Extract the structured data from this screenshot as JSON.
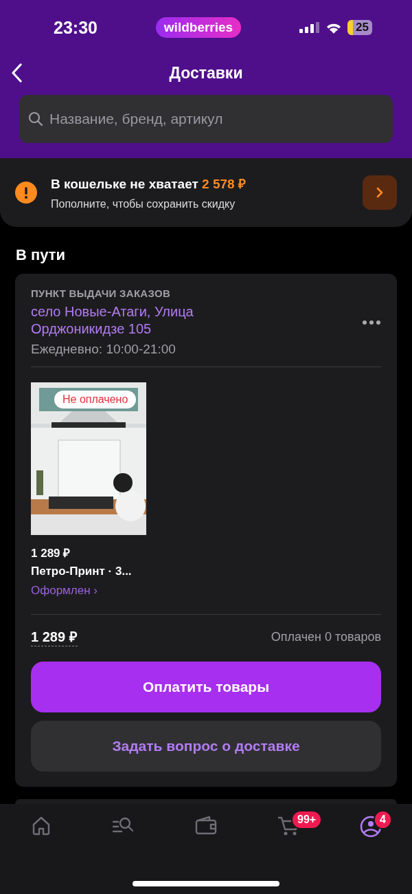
{
  "status_bar": {
    "time": "23:30",
    "app_pill": "wildberries",
    "battery": "25"
  },
  "header": {
    "title": "Доставки",
    "search": {
      "placeholder": "Название, бренд, артикул"
    }
  },
  "wallet_banner": {
    "title": "В кошельке не хватает **2 578 ₽**",
    "subtitle": "Пополните, чтобы сохранить скидку"
  },
  "section_title": "В пути",
  "delivery": {
    "point_label": "ПУНКТ ВЫДАЧИ ЗАКАЗОВ",
    "address": "село Новые-Атаги, Улица Орджоникидзе 105",
    "hours": "Ежедневно: 10:00-21:00",
    "items": [
      {
        "kind": "picture",
        "badge": "Не оплачено",
        "price": "1 289 ₽",
        "name": "Петро-Принт · 3...",
        "status": "Оформлен ›"
      }
    ],
    "total": "1 289 ₽",
    "paid_count": "Оплачен 0 товаров",
    "pay_button": "Оплатить товары",
    "ask_button": "Задать вопрос о доставке"
  },
  "tab_bar": [
    {
      "kind": "home",
      "selected": false
    },
    {
      "kind": "catalog",
      "selected": false
    },
    {
      "kind": "wallet",
      "selected": false
    },
    {
      "kind": "cart",
      "selected": false,
      "badge": "99+"
    },
    {
      "kind": "profile",
      "selected": true,
      "badge": "4"
    }
  ]
}
